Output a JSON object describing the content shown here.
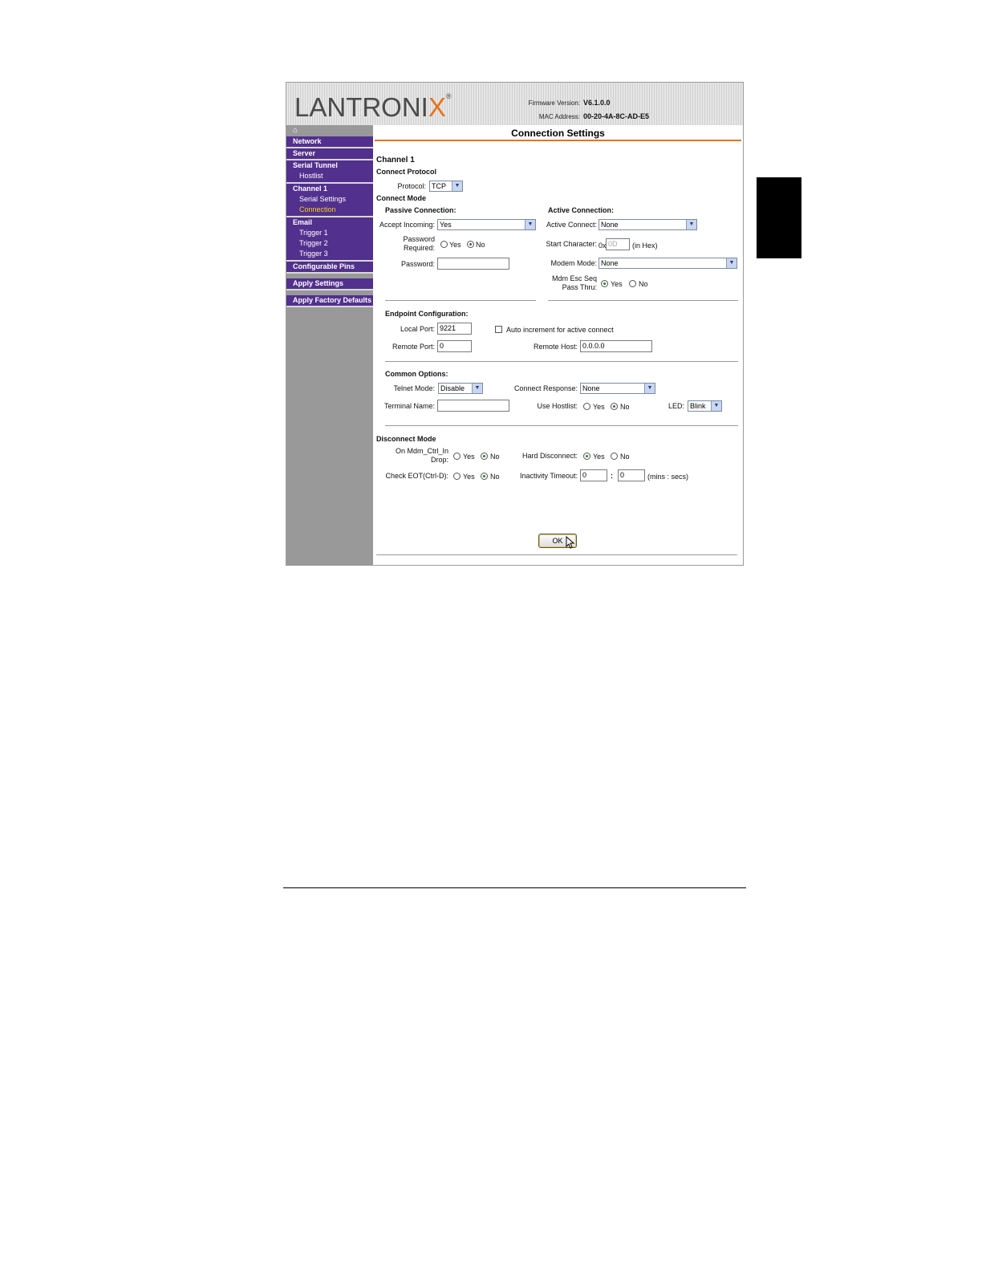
{
  "header": {
    "logo": "LANTRONIX",
    "firmware_label": "Firmware Version:",
    "firmware_value": "V6.1.0.0",
    "mac_label": "MAC Address:",
    "mac_value": "00-20-4A-8C-AD-E5"
  },
  "sidebar": {
    "home_icon": "home-icon",
    "network": "Network",
    "server": "Server",
    "serial_tunnel": "Serial Tunnel",
    "hostlist": "Hostlist",
    "channel1": "Channel 1",
    "serial_settings": "Serial Settings",
    "connection": "Connection",
    "email": "Email",
    "trigger1": "Trigger 1",
    "trigger2": "Trigger 2",
    "trigger3": "Trigger 3",
    "configurable_pins": "Configurable Pins",
    "apply_settings": "Apply Settings",
    "apply_factory_defaults": "Apply Factory Defaults"
  },
  "page": {
    "title": "Connection Settings",
    "channel": "Channel 1",
    "connect_protocol": "Connect Protocol",
    "protocol_label": "Protocol:",
    "protocol_value": "TCP",
    "connect_mode": "Connect Mode",
    "passive_heading": "Passive Connection:",
    "accept_incoming_label": "Accept Incoming:",
    "accept_incoming_value": "Yes",
    "password_required_label_1": "Password",
    "password_required_label_2": "Required:",
    "yes": "Yes",
    "no": "No",
    "password_label": "Password:",
    "password_value": "",
    "active_heading": "Active Connection:",
    "active_connect_label": "Active Connect:",
    "active_connect_value": "None",
    "start_char_label": "Start Character:",
    "start_char_prefix": "0x",
    "start_char_value": "0D",
    "in_hex": "(in Hex)",
    "modem_mode_label": "Modem Mode:",
    "modem_mode_value": "None",
    "mdm_esc_label_1": "Mdm Esc Seq",
    "mdm_esc_label_2": "Pass Thru:",
    "endpoint_heading": "Endpoint Configuration:",
    "local_port_label": "Local Port:",
    "local_port_value": "9221",
    "auto_increment_label": "Auto increment for active connect",
    "remote_port_label": "Remote Port:",
    "remote_port_value": "0",
    "remote_host_label": "Remote Host:",
    "remote_host_value": "0.0.0.0",
    "common_heading": "Common Options:",
    "telnet_mode_label": "Telnet Mode:",
    "telnet_mode_value": "Disable",
    "connect_response_label": "Connect Response:",
    "connect_response_value": "None",
    "terminal_name_label": "Terminal Name:",
    "terminal_name_value": "",
    "use_hostlist_label": "Use Hostlist:",
    "led_label": "LED:",
    "led_value": "Blink",
    "disconnect_heading": "Disconnect Mode",
    "mdm_ctrl_label_1": "On Mdm_Ctrl_In",
    "mdm_ctrl_label_2": "Drop:",
    "hard_disconnect_label": "Hard Disconnect:",
    "check_eot_label": "Check EOT(Ctrl-D):",
    "inactivity_label": "Inactivity Timeout:",
    "inactivity_min": "0",
    "inactivity_colon": ":",
    "inactivity_sec": "0",
    "mins_secs": "(mins : secs)",
    "ok_label": "OK"
  },
  "colors": {
    "nav_purple": "#52308e",
    "sidebar_gray": "#999999",
    "accent_orange": "#e8721c",
    "active_nav_yellow": "#f2d21a"
  }
}
